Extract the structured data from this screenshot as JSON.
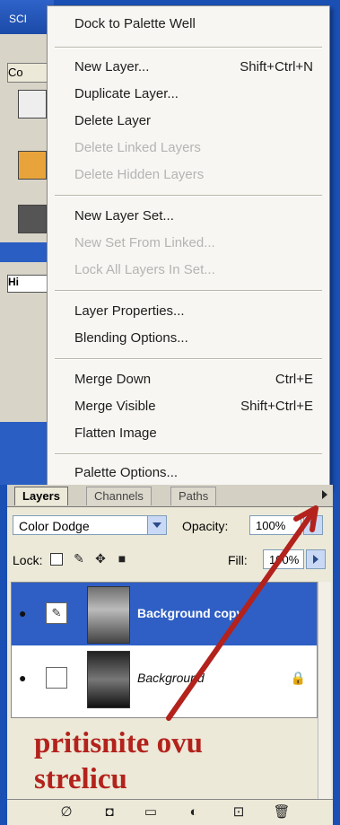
{
  "window": {
    "title_fragment": "SCI"
  },
  "left_strip": {
    "tab_label": "Hi",
    "box_label": "Co"
  },
  "context_menu": {
    "items": [
      {
        "label": "Dock to Palette Well",
        "shortcut": "",
        "enabled": true
      },
      {
        "label": "New Layer...",
        "shortcut": "Shift+Ctrl+N",
        "enabled": true
      },
      {
        "label": "Duplicate Layer...",
        "shortcut": "",
        "enabled": true
      },
      {
        "label": "Delete Layer",
        "shortcut": "",
        "enabled": true
      },
      {
        "label": "Delete Linked Layers",
        "shortcut": "",
        "enabled": false
      },
      {
        "label": "Delete Hidden Layers",
        "shortcut": "",
        "enabled": false
      },
      {
        "label": "New Layer Set...",
        "shortcut": "",
        "enabled": true
      },
      {
        "label": "New Set From Linked...",
        "shortcut": "",
        "enabled": false
      },
      {
        "label": "Lock All Layers In Set...",
        "shortcut": "",
        "enabled": false
      },
      {
        "label": "Layer Properties...",
        "shortcut": "",
        "enabled": true
      },
      {
        "label": "Blending Options...",
        "shortcut": "",
        "enabled": true
      },
      {
        "label": "Merge Down",
        "shortcut": "Ctrl+E",
        "enabled": true
      },
      {
        "label": "Merge Visible",
        "shortcut": "Shift+Ctrl+E",
        "enabled": true
      },
      {
        "label": "Flatten Image",
        "shortcut": "",
        "enabled": true
      },
      {
        "label": "Palette Options...",
        "shortcut": "",
        "enabled": true
      }
    ]
  },
  "layers_panel": {
    "tabs": [
      {
        "label": "Layers",
        "active": true
      },
      {
        "label": "Channels",
        "active": false
      },
      {
        "label": "Paths",
        "active": false
      }
    ],
    "blend_mode": "Color Dodge",
    "opacity_label": "Opacity:",
    "opacity_value": "100%",
    "lock_label": "Lock:",
    "fill_label": "Fill:",
    "fill_value": "100%",
    "layers": [
      {
        "name": "Background copy",
        "selected": true,
        "icon": "paintbrush-icon"
      },
      {
        "name": "Background",
        "selected": false,
        "icon": "lock-icon"
      }
    ]
  },
  "annotation": {
    "line1": "pritisnite ovu",
    "line2": "strelicu",
    "color": "#b3221c"
  },
  "colors": {
    "selection": "#2f5fc4",
    "panel_bg": "#ece9d8",
    "arrow": "#b3221c"
  }
}
